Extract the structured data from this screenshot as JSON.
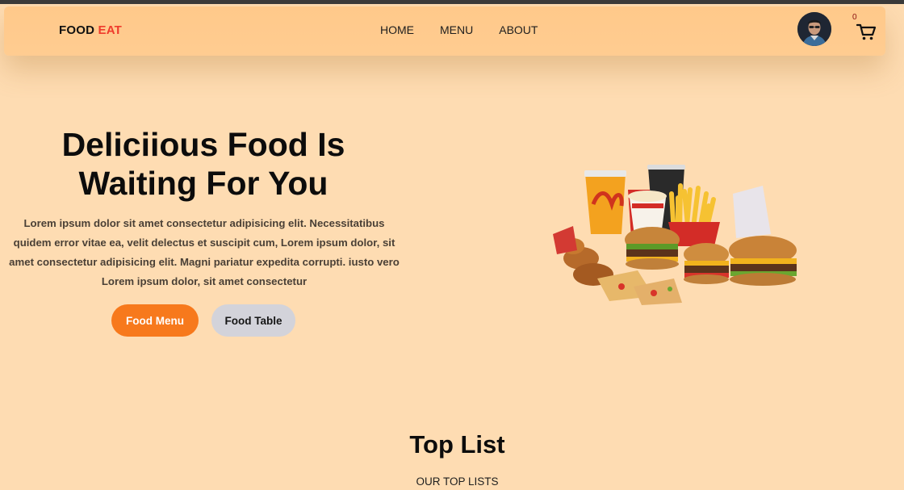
{
  "brand": {
    "name_part1": "FOOD",
    "name_part2": "EAT",
    "accent_color": "#ef3b2c"
  },
  "nav": {
    "items": [
      {
        "label": "HOME"
      },
      {
        "label": "MENU"
      },
      {
        "label": "ABOUT"
      }
    ]
  },
  "header": {
    "avatar_icon": "user-avatar",
    "cart_icon": "cart-icon",
    "cart_count": "0"
  },
  "hero": {
    "title": "Deliciious Food Is Waiting For You",
    "description": "Lorem ipsum dolor sit amet consectetur adipisicing elit. Necessitatibus quidem error vitae ea, velit delectus et suscipit cum, Lorem ipsum dolor, sit amet consectetur adipisicing elit. Magni pariatur expedita corrupti. iusto vero Lorem ipsum dolor, sit amet consectetur",
    "primary_button": "Food Menu",
    "secondary_button": "Food Table",
    "primary_color": "#f7791c",
    "secondary_color": "#d3d3da"
  },
  "top_list": {
    "title": "Top List",
    "subtitle": "OUR TOP LISTS"
  }
}
